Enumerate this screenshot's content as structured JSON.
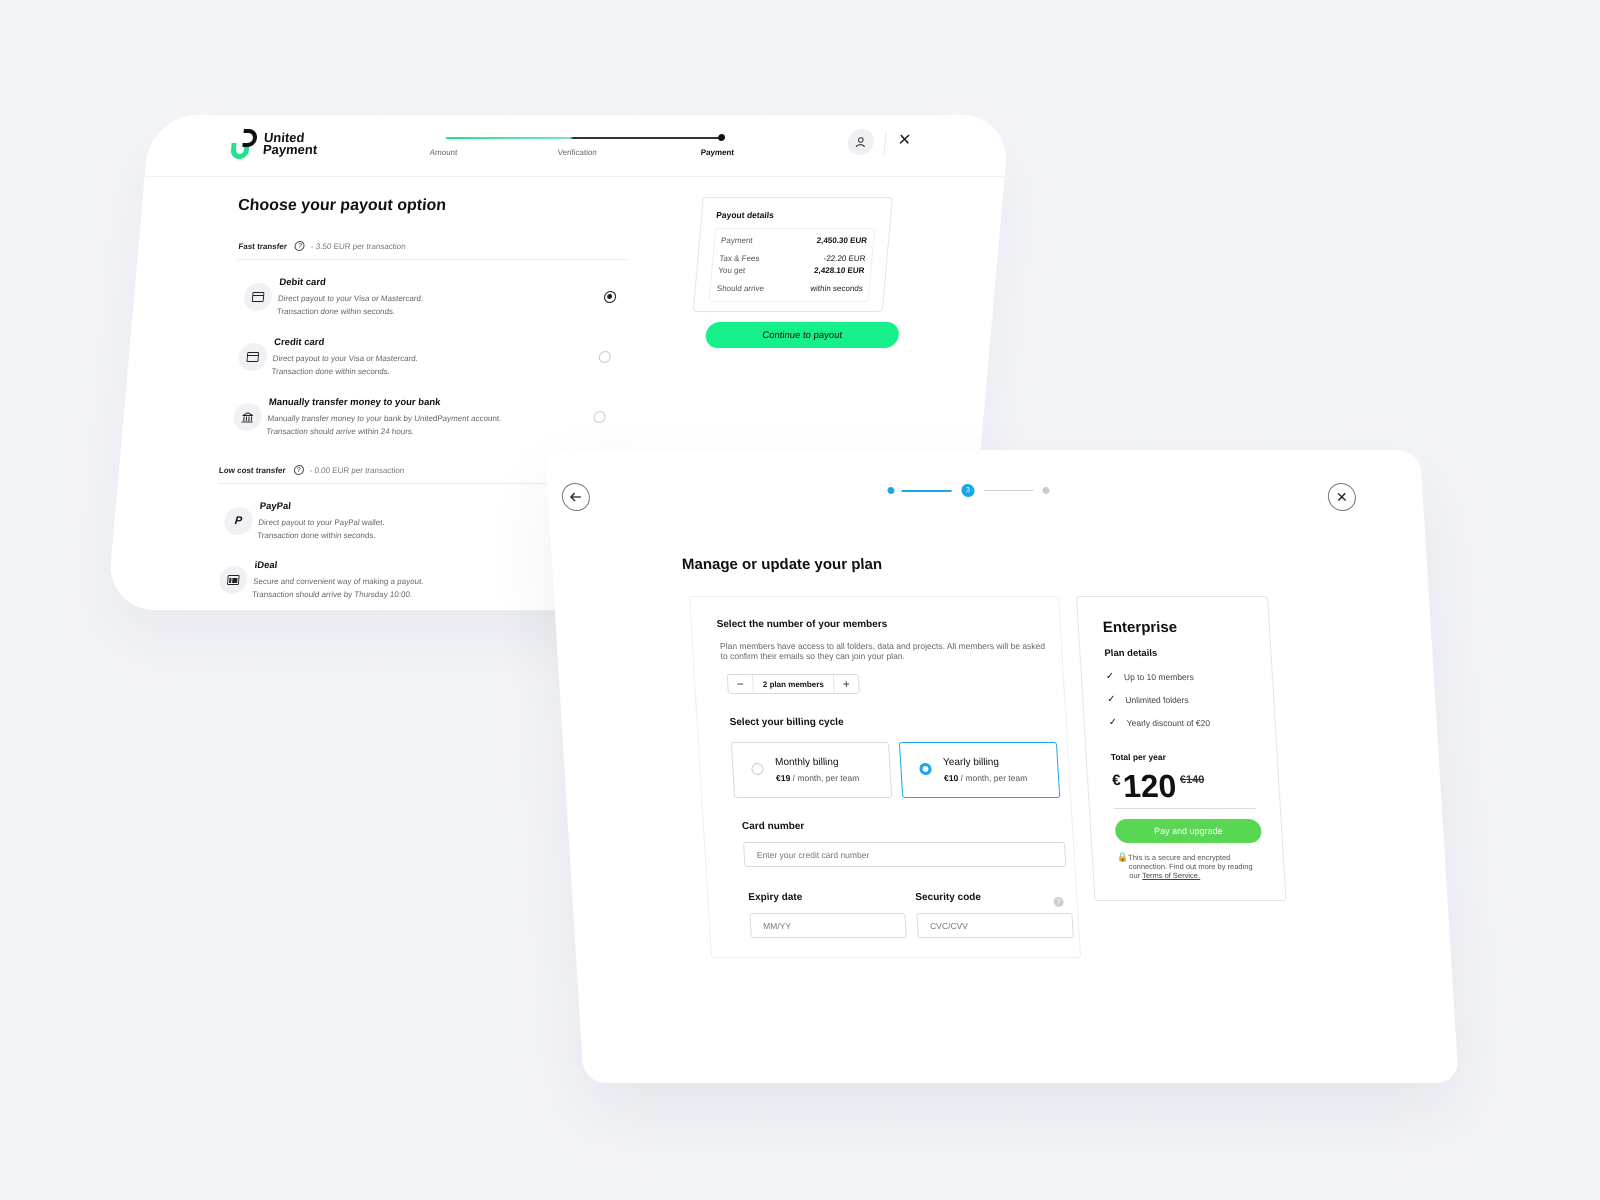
{
  "payout": {
    "brand": {
      "line1": "United",
      "line2": "Payment"
    },
    "steps": [
      "Amount",
      "Verification",
      "Payment"
    ],
    "title": "Choose your payout option",
    "fast": {
      "name": "Fast transfer",
      "note": "- 3.50 EUR per transaction"
    },
    "options": [
      {
        "title": "Debit card",
        "desc1": "Direct payout to your Visa or Mastercard.",
        "desc2": "Transaction done within seconds.",
        "icon": "card-icon"
      },
      {
        "title": "Credit card",
        "desc1": "Direct payout to your Visa or Mastercard.",
        "desc2": "Transaction done within seconds.",
        "icon": "card-icon"
      },
      {
        "title": "Manually transfer money to your bank",
        "desc1": "Manually transfer money to your bank by UnitedPayment account.",
        "desc2": "Transaction should arrive within 24 hours.",
        "icon": "bank-icon"
      }
    ],
    "low": {
      "name": "Low cost transfer",
      "note": "- 0.00 EUR per transaction"
    },
    "low_options": [
      {
        "title": "PayPal",
        "desc1": "Direct payout to your PayPal wallet.",
        "desc2": "Transaction done within seconds.",
        "icon": "paypal-icon"
      },
      {
        "title": "iDeal",
        "desc1": "Secure and convenient way of making a payout.",
        "desc2": "Transaction should arrive by Thursday 10:00.",
        "icon": "ideal-icon"
      }
    ],
    "details": {
      "title": "Payout details",
      "rows": [
        {
          "k": "Payment",
          "v": "2,450.30 EUR"
        },
        {
          "k": "Tax & Fees",
          "v": "-22.20 EUR"
        },
        {
          "k": "You get",
          "v": "2,428.10 EUR"
        },
        {
          "k": "Should arrive",
          "v": "within seconds"
        }
      ]
    },
    "continue_label": "Continue to payout"
  },
  "plan": {
    "step_current": "3",
    "title": "Manage or update your plan",
    "members_heading": "Select the number of your members",
    "members_desc": "Plan members have access to all folders, data and projects. All members will be asked to confirm their emails so they can join your plan.",
    "qty_label": "2 plan members",
    "minus": "−",
    "plus": "+",
    "billing_heading": "Select your billing cycle",
    "billing": [
      {
        "title": "Monthly billing",
        "price": "€19",
        "unit": " / month, per team"
      },
      {
        "title": "Yearly billing",
        "price": "€10",
        "unit": " / month, per team"
      }
    ],
    "card_label": "Card number",
    "card_placeholder": "Enter your credit card number",
    "expiry_label": "Expiry date",
    "expiry_placeholder": "MM/YY",
    "security_label": "Security code",
    "security_placeholder": "CVC/CVV",
    "help": "?",
    "enterprise": {
      "title": "Enterprise",
      "details_label": "Plan details",
      "features": [
        "Up to 10 members",
        "Unlimited folders",
        "Yearly discount of €20"
      ],
      "total_label": "Total per year",
      "currency": "€",
      "price": "120",
      "old_price": "€140",
      "pay_label": "Pay and upgrade",
      "secure_text": "This is a secure and encrypted connection. Find out more by reading our ",
      "terms": "Terms of Service."
    }
  }
}
